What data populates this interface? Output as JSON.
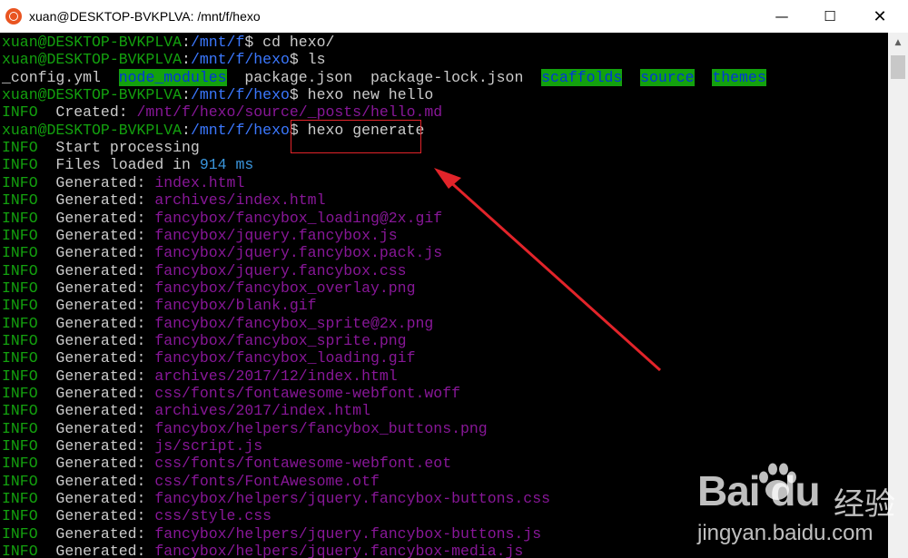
{
  "window": {
    "title": "xuan@DESKTOP-BVKPLVA: /mnt/f/hexo",
    "buttons": {
      "minimize": "—",
      "maximize": "☐",
      "close": "✕"
    }
  },
  "terminal": {
    "lines": [
      {
        "user": "xuan@DESKTOP-BVKPLVA",
        "sep": ":",
        "path": "/mnt/f",
        "prompt": "$",
        "cmd": " cd hexo/"
      },
      {
        "user": "xuan@DESKTOP-BVKPLVA",
        "sep": ":",
        "path": "/mnt/f/hexo",
        "prompt": "$",
        "cmd": " ls"
      },
      {
        "ls": [
          "_config.yml",
          "node_modules",
          "package.json",
          "package-lock.json",
          "scaffolds",
          "source",
          "themes"
        ]
      },
      {
        "user": "xuan@DESKTOP-BVKPLVA",
        "sep": ":",
        "path": "/mnt/f/hexo",
        "prompt": "$",
        "cmd": " hexo new hello"
      },
      {
        "level": "INFO",
        "text": "  Created: ",
        "value": "/mnt/f/hexo/source/_posts/hello.md"
      },
      {
        "user": "xuan@DESKTOP-BVKPLVA",
        "sep": ":",
        "path": "/mnt/f/hexo",
        "prompt": "$",
        "cmd": " hexo generate"
      },
      {
        "level": "INFO",
        "text": "  Start processing",
        "value": ""
      },
      {
        "level": "INFO",
        "text": "  Files loaded in ",
        "value": "914 ms"
      },
      {
        "level": "INFO",
        "text": "  Generated: ",
        "value": "index.html"
      },
      {
        "level": "INFO",
        "text": "  Generated: ",
        "value": "archives/index.html"
      },
      {
        "level": "INFO",
        "text": "  Generated: ",
        "value": "fancybox/fancybox_loading@2x.gif"
      },
      {
        "level": "INFO",
        "text": "  Generated: ",
        "value": "fancybox/jquery.fancybox.js"
      },
      {
        "level": "INFO",
        "text": "  Generated: ",
        "value": "fancybox/jquery.fancybox.pack.js"
      },
      {
        "level": "INFO",
        "text": "  Generated: ",
        "value": "fancybox/jquery.fancybox.css"
      },
      {
        "level": "INFO",
        "text": "  Generated: ",
        "value": "fancybox/fancybox_overlay.png"
      },
      {
        "level": "INFO",
        "text": "  Generated: ",
        "value": "fancybox/blank.gif"
      },
      {
        "level": "INFO",
        "text": "  Generated: ",
        "value": "fancybox/fancybox_sprite@2x.png"
      },
      {
        "level": "INFO",
        "text": "  Generated: ",
        "value": "fancybox/fancybox_sprite.png"
      },
      {
        "level": "INFO",
        "text": "  Generated: ",
        "value": "fancybox/fancybox_loading.gif"
      },
      {
        "level": "INFO",
        "text": "  Generated: ",
        "value": "archives/2017/12/index.html"
      },
      {
        "level": "INFO",
        "text": "  Generated: ",
        "value": "css/fonts/fontawesome-webfont.woff"
      },
      {
        "level": "INFO",
        "text": "  Generated: ",
        "value": "archives/2017/index.html"
      },
      {
        "level": "INFO",
        "text": "  Generated: ",
        "value": "fancybox/helpers/fancybox_buttons.png"
      },
      {
        "level": "INFO",
        "text": "  Generated: ",
        "value": "js/script.js"
      },
      {
        "level": "INFO",
        "text": "  Generated: ",
        "value": "css/fonts/fontawesome-webfont.eot"
      },
      {
        "level": "INFO",
        "text": "  Generated: ",
        "value": "css/fonts/FontAwesome.otf"
      },
      {
        "level": "INFO",
        "text": "  Generated: ",
        "value": "fancybox/helpers/jquery.fancybox-buttons.css"
      },
      {
        "level": "INFO",
        "text": "  Generated: ",
        "value": "css/style.css"
      },
      {
        "level": "INFO",
        "text": "  Generated: ",
        "value": "fancybox/helpers/jquery.fancybox-buttons.js"
      },
      {
        "level": "INFO",
        "text": "  Generated: ",
        "value": "fancybox/helpers/jquery.fancybox-media.js"
      }
    ]
  },
  "watermark": {
    "logo": "Bai du",
    "cn": "经验",
    "url": "jingyan.baidu.com"
  },
  "colors": {
    "prompt_user": "#13a10e",
    "prompt_path": "#3b78ff",
    "info": "#13a10e",
    "generated_path": "#881798",
    "timing": "#3a96dd",
    "annotation": "#e2242a"
  }
}
